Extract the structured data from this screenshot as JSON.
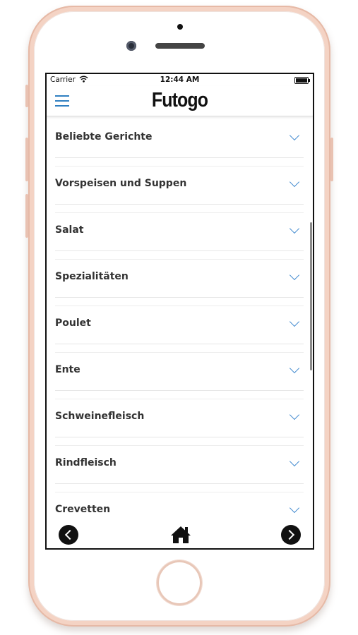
{
  "status_bar": {
    "carrier": "Carrier",
    "time": "12:44 AM"
  },
  "header": {
    "logo": "Futogo",
    "menu_icon": "hamburger-menu-icon"
  },
  "menu": {
    "categories": [
      {
        "label": "Beliebte Gerichte"
      },
      {
        "label": "Vorspeisen und Suppen"
      },
      {
        "label": "Salat"
      },
      {
        "label": "Spezialitäten"
      },
      {
        "label": "Poulet"
      },
      {
        "label": "Ente"
      },
      {
        "label": "Schweinefleisch"
      },
      {
        "label": "Rindfleisch"
      },
      {
        "label": "Crevetten"
      }
    ],
    "expand_icon": "chevron-down-icon"
  },
  "controls": {
    "back_to_top_icon": "arrow-up-icon"
  },
  "footer": {
    "prev_icon": "chevron-left-icon",
    "home_icon": "home-icon",
    "next_icon": "chevron-right-icon"
  },
  "colors": {
    "accent": "#2f7fc1",
    "chevron": "#4a8fd1",
    "phone_frame": "#f4d3c4"
  }
}
